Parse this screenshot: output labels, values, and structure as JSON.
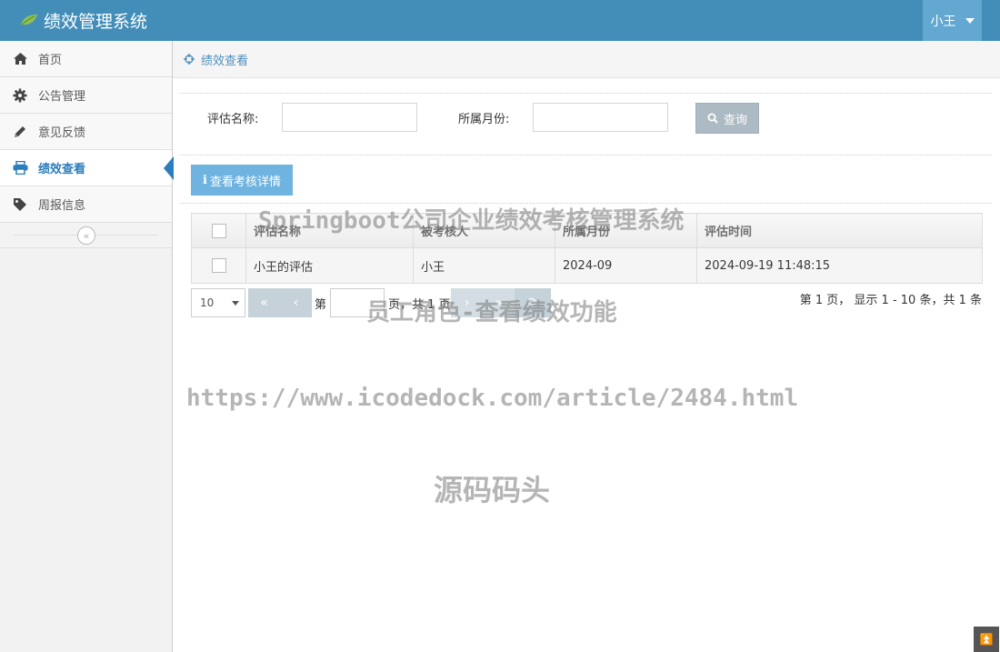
{
  "header": {
    "title": "绩效管理系统",
    "user": "小王"
  },
  "sidebar": {
    "items": [
      {
        "label": "首页",
        "icon": "home-icon"
      },
      {
        "label": "公告管理",
        "icon": "gear-icon"
      },
      {
        "label": "意见反馈",
        "icon": "pencil-icon"
      },
      {
        "label": "绩效查看",
        "icon": "print-icon",
        "active": true
      },
      {
        "label": "周报信息",
        "icon": "tag-icon"
      }
    ],
    "collapse_icon": "double-chevron-left-icon"
  },
  "breadcrumb": {
    "label": "绩效查看"
  },
  "search": {
    "name_label": "评估名称:",
    "name_value": "",
    "month_label": "所属月份:",
    "month_value": "",
    "query_label": "查询"
  },
  "toolbar": {
    "detail_label": "查看考核详情"
  },
  "table": {
    "headers": [
      "评估名称",
      "被考核人",
      "所属月份",
      "评估时间"
    ],
    "rows": [
      [
        "小王的评估",
        "小王",
        "2024-09",
        "2024-09-19 11:48:15"
      ]
    ]
  },
  "pagination": {
    "page_size": "10",
    "page_label": "第",
    "page_value": "",
    "total_pages_text": "页，共 1 页",
    "info": "第 1 页，  显示 1 - 10 条，共 1 条"
  },
  "watermarks": {
    "line1": "Springboot公司企业绩效考核管理系统",
    "line2": "员工角色-查看绩效功能",
    "line3": "https://www.icodedock.com/article/2484.html",
    "line4": "源码码头"
  },
  "colors": {
    "header": "#438eb9",
    "user_button": "#62a8d1",
    "active_nav": "#2b7dbc",
    "detail_button": "#6fb3e0",
    "query_button": "#abbac3"
  }
}
